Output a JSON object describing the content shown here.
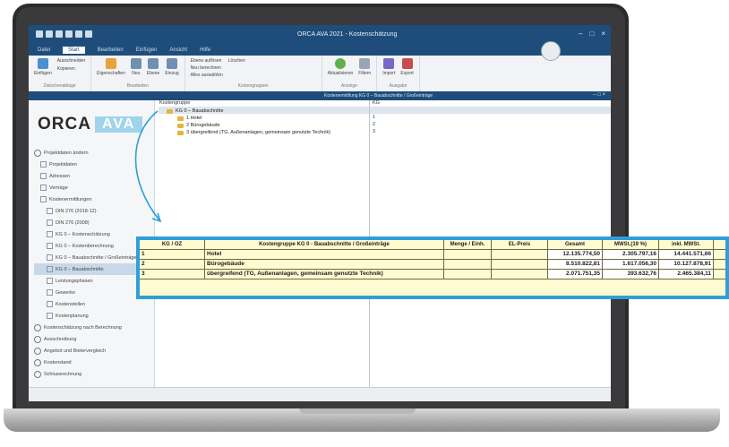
{
  "app": {
    "title": "ORCA AVA 2021 - Kostenschätzung",
    "window_controls": [
      "–",
      "□",
      "×"
    ],
    "document_title": "Kostenermittlung KG 0 – Bauabschnitte / Großeinträge",
    "tabs": [
      "Datei",
      "Start",
      "Bearbeiten",
      "Einfügen",
      "Ansicht",
      "Hilfe"
    ],
    "active_tab": "Start"
  },
  "ribbon": {
    "groups": [
      {
        "label": "Zwischenablage",
        "buttons": [
          "Einfügen",
          "Ausschneiden",
          "Kopieren"
        ]
      },
      {
        "label": "Bearbeiten",
        "buttons": [
          "Eigenschaften",
          "Neu",
          "Ebene",
          "Einzug"
        ]
      },
      {
        "label": "Kostengruppen",
        "buttons": [
          "Ebene auflösen",
          "Löschen",
          "Neu berechnen",
          "Alles auswählen"
        ]
      },
      {
        "label": "Anzeige",
        "buttons": [
          "Aktualisieren",
          "Filtern"
        ]
      },
      {
        "label": "Ausgabe",
        "buttons": [
          "Import",
          "Export"
        ]
      }
    ],
    "icon_colors": [
      "#4a8fd0",
      "#e6a23c",
      "#5fb04a",
      "#c94c4c",
      "#7a66c7"
    ]
  },
  "sidebar": {
    "logo_left": "ORCA",
    "logo_right": "AVA",
    "items": [
      {
        "label": "Projektdaten ändern",
        "level": 0
      },
      {
        "label": "Projektdaten",
        "level": 1
      },
      {
        "label": "Adressen",
        "level": 1
      },
      {
        "label": "Verträge",
        "level": 1
      },
      {
        "label": "Kostenermittlungen",
        "level": 1
      },
      {
        "label": "DIN 276 (2018-12)",
        "level": 2
      },
      {
        "label": "DIN 276 (2008)",
        "level": 2
      },
      {
        "label": "KG 0 – Kostenschätzung",
        "level": 2
      },
      {
        "label": "KG 0 – Kostenberechnung",
        "level": 2
      },
      {
        "label": "KG 0 – Bauabschnitte / Großeinträge",
        "level": 2
      },
      {
        "label": "KG 0 – Bauabschnitte",
        "level": 2,
        "selected": true
      },
      {
        "label": "Leistungsphasen",
        "level": 2
      },
      {
        "label": "Gewerke",
        "level": 2
      },
      {
        "label": "Kostenstellen",
        "level": 2
      },
      {
        "label": "Kostenplanung",
        "level": 2
      },
      {
        "label": "Kostenschätzung nach Berechnung",
        "level": 0
      },
      {
        "label": "Ausschreibung",
        "level": 0
      },
      {
        "label": "Angebot und Bietervergleich",
        "level": 0
      },
      {
        "label": "Kostenstand",
        "level": 0
      },
      {
        "label": "Schlussrechnung",
        "level": 0
      }
    ]
  },
  "tree": {
    "column_header": "Kostengruppe",
    "kg_header": "KG",
    "nodes": [
      {
        "label": "KG 0 – Bauabschnitte",
        "level": 0,
        "kg": ""
      },
      {
        "label": "1 Hotel",
        "level": 1,
        "kg": "1"
      },
      {
        "label": "2 Bürogebäude",
        "level": 1,
        "kg": "2"
      },
      {
        "label": "3 übergreifend (TG, Außenanlagen, gemeinsam genutzte Technik)",
        "level": 1,
        "kg": "3"
      }
    ]
  },
  "table": {
    "headers": [
      "KG / OZ",
      "Kostengruppe KG 0 - Bauabschnitte / Großeinträge",
      "Menge / Einh.",
      "EL-Preis",
      "Gesamt",
      "MWSt.(19 %)",
      "inkl. MWSt."
    ],
    "rows": [
      {
        "kg": "1",
        "name": "Hotel",
        "menge": "",
        "ep": "",
        "gesamt": "12.135.774,50",
        "mwst": "2.305.797,16",
        "inkl": "14.441.571,66"
      },
      {
        "kg": "2",
        "name": "Bürogebäude",
        "menge": "",
        "ep": "",
        "gesamt": "8.510.822,81",
        "mwst": "1.617.056,30",
        "inkl": "10.127.878,91"
      },
      {
        "kg": "3",
        "name": "übergreifend (TG, Außenanlagen, gemeinsam genutzte Technik)",
        "menge": "",
        "ep": "",
        "gesamt": "2.071.751,35",
        "mwst": "393.632,76",
        "inkl": "2.465.384,11"
      }
    ]
  },
  "colors": {
    "title_bar": "#1e4d7b",
    "callout_border": "#2e9fd8",
    "table_bg": "#fffbd1",
    "selected_nav": "#c9d8e8",
    "folder": "#e7b33c"
  }
}
